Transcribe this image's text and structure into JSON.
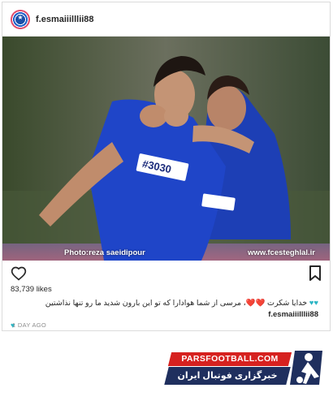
{
  "post": {
    "username": "f.esmaiiilllii88",
    "photo_credit_left": "Photo:reza saeidipour",
    "photo_credit_right": "www.fcesteghlal.ir",
    "jersey_text": "#3030",
    "likes": "83,739 likes",
    "caption_owner": "f.esmaiiilllii88",
    "caption_text": "خدایا شکرت ❤️❤️، مرسی از شما هوادارا که تو این بارون شدید ما رو تنها نذاشتین",
    "caption_hearts_prefix": "♥♥",
    "caption_heart_suffix": "♥",
    "timestamp": "1 DAY AGO"
  },
  "branding": {
    "site": "PARSFOOTBALL.COM",
    "tagline": "خبرگزاری فوتبال ایران"
  },
  "colors": {
    "accent_red": "#d6211f",
    "accent_navy": "#1f2f5e",
    "jersey_blue": "#1f45c8",
    "heart_teal": "#2bb5c4"
  },
  "icons": {
    "like": "heart-outline-icon",
    "save": "bookmark-icon",
    "brand": "soccer-player-icon"
  }
}
